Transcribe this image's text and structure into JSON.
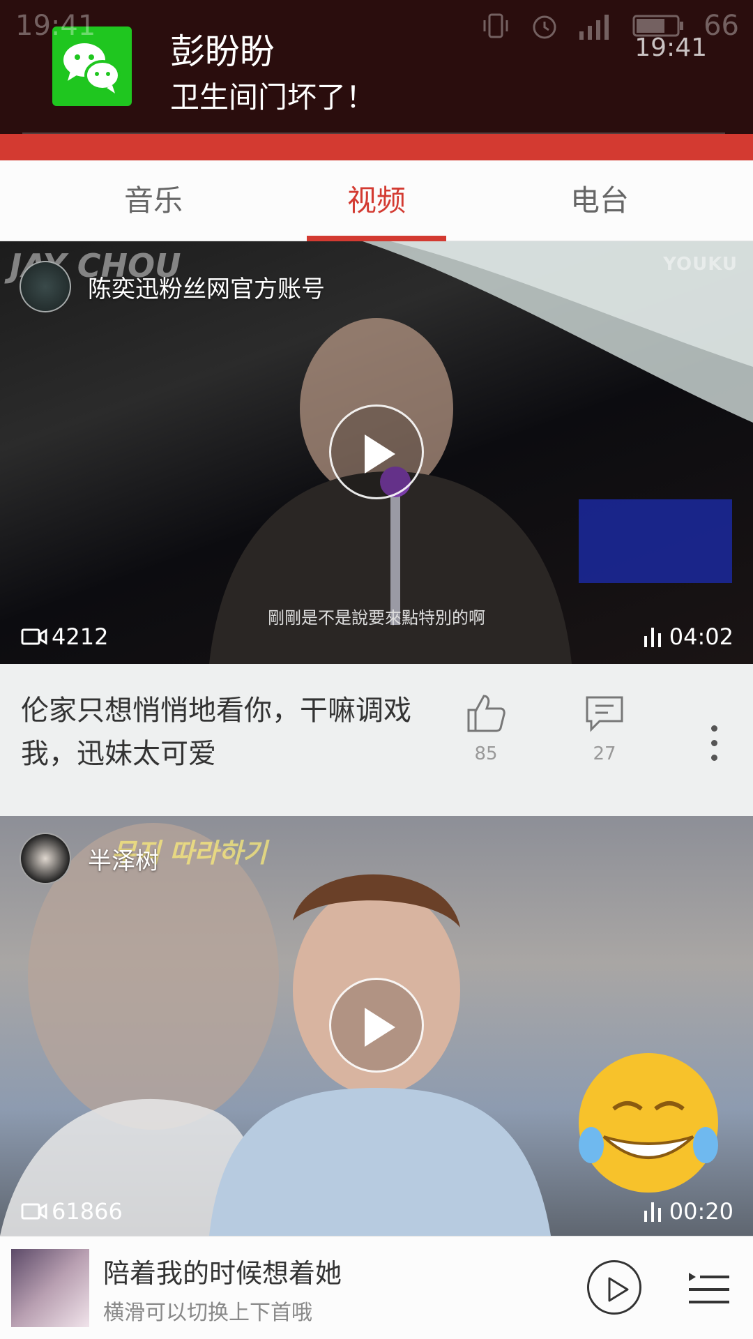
{
  "status_bar": {
    "time": "19:41",
    "battery": "66"
  },
  "notification": {
    "app_icon": "wechat-icon",
    "title": "彭盼盼",
    "body": "卫生间门坏了！",
    "time": "19:41"
  },
  "header": {
    "icons": [
      "menu-icon",
      "music-icon",
      "netease-logo-icon",
      "friends-icon",
      "search-icon"
    ]
  },
  "tabs": [
    {
      "label": "音乐",
      "active": false
    },
    {
      "label": "视频",
      "active": true
    },
    {
      "label": "电台",
      "active": false
    }
  ],
  "videos": [
    {
      "uploader": "陈奕迅粉丝网官方账号",
      "views": "4212",
      "duration": "04:02",
      "caption": "伦家只想悄悄地看你，干嘛调戏我，迅妹太可爱",
      "likes": "85",
      "comments": "27",
      "overlay_text": "JAY CHOU",
      "watermark": "YOUKU",
      "subtitle": "剛剛是不是說要來點特別的啊"
    },
    {
      "uploader": "半泽树",
      "views": "61866",
      "duration": "00:20",
      "overlay_text": "무지 따라하기"
    }
  ],
  "mini_player": {
    "title": "陪着我的时候想着她",
    "subtitle": "横滑可以切换上下首哦"
  },
  "colors": {
    "accent": "#d33a31",
    "wechat_green": "#1fc61f"
  }
}
